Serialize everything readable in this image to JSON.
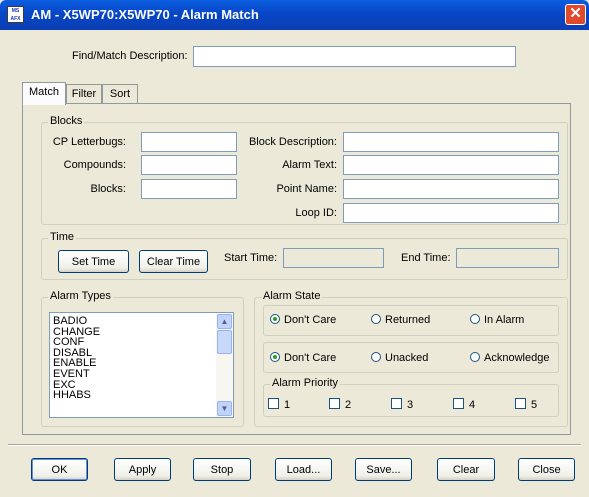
{
  "window": {
    "title": "AM - X5WP70:X5WP70 - Alarm Match",
    "app_icon_text": "MS AFX",
    "close_glyph": "✕"
  },
  "find": {
    "label": "Find/Match Description:",
    "value": ""
  },
  "tabs": [
    {
      "label": "Match",
      "active": true
    },
    {
      "label": "Filter",
      "active": false
    },
    {
      "label": "Sort",
      "active": false
    }
  ],
  "blocks": {
    "group_label": "Blocks",
    "cp_letterbugs_label": "CP Letterbugs:",
    "compounds_label": "Compounds:",
    "blocks_label": "Blocks:",
    "block_description_label": "Block Description:",
    "alarm_text_label": "Alarm Text:",
    "point_name_label": "Point Name:",
    "loop_id_label": "Loop ID:"
  },
  "time": {
    "group_label": "Time",
    "set_time_label": "Set Time",
    "clear_time_label": "Clear Time",
    "start_time_label": "Start Time:",
    "end_time_label": "End Time:"
  },
  "alarm_types": {
    "group_label": "Alarm Types",
    "items": [
      "BADIO",
      "CHANGE",
      "CONF",
      "DISABL",
      "ENABLE",
      "EVENT",
      "EXC",
      "HHABS"
    ]
  },
  "alarm_state": {
    "group_label": "Alarm State",
    "row1": [
      "Don't Care",
      "Returned",
      "In Alarm"
    ],
    "row2": [
      "Don't Care",
      "Unacked",
      "Acknowledge"
    ],
    "selected_row1": "Don't Care",
    "selected_row2": "Don't Care"
  },
  "alarm_priority": {
    "group_label": "Alarm Priority",
    "options": [
      "1",
      "2",
      "3",
      "4",
      "5"
    ]
  },
  "buttons": {
    "ok": "OK",
    "apply": "Apply",
    "stop": "Stop",
    "load": "Load...",
    "save": "Save...",
    "clear": "Clear",
    "close": "Close"
  },
  "colors": {
    "titlebar": "#0a5fe0",
    "dialog_bg": "#ece9d8",
    "close_button": "#e04a2a"
  }
}
